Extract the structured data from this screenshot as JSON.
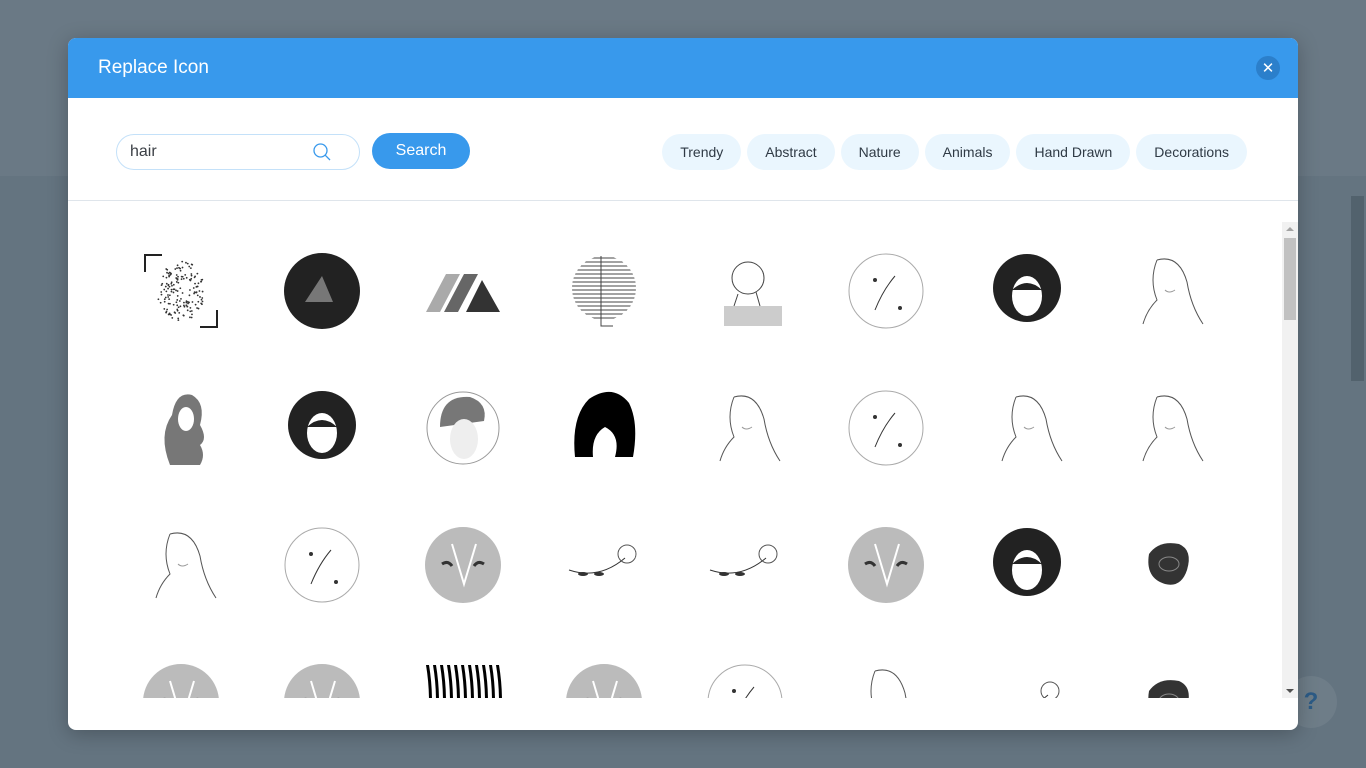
{
  "dialog": {
    "title": "Replace Icon",
    "close_icon": "close-icon",
    "search": {
      "value": "hair",
      "placeholder": "",
      "button_label": "Search"
    },
    "categories": [
      "Trendy",
      "Abstract",
      "Nature",
      "Animals",
      "Hand Drawn",
      "Decorations"
    ],
    "icons": [
      {
        "name": "fingerprint-frame",
        "style": "dots"
      },
      {
        "name": "triangle-dark-circle",
        "style": "dark-circle-triangle"
      },
      {
        "name": "stripes-logo",
        "style": "stripes"
      },
      {
        "name": "line-circle",
        "style": "line-circle"
      },
      {
        "name": "statue-bust",
        "style": "bust"
      },
      {
        "name": "feather-circle",
        "style": "outline-circle"
      },
      {
        "name": "woman-hat",
        "style": "dark-face"
      },
      {
        "name": "woman-long-hair-outline",
        "style": "outline-face"
      },
      {
        "name": "wavy-hair-woman",
        "style": "gray-hair"
      },
      {
        "name": "woman-sunglasses-moon",
        "style": "dark-face"
      },
      {
        "name": "woman-flower-circle",
        "style": "gray-face-circle"
      },
      {
        "name": "black-bob-hair",
        "style": "black-hair"
      },
      {
        "name": "bob-hair-outline",
        "style": "outline-face"
      },
      {
        "name": "woman-rose-circle",
        "style": "outline-circle"
      },
      {
        "name": "woman-leaves-hair",
        "style": "outline-face"
      },
      {
        "name": "woman-leaves-outline",
        "style": "outline-face"
      },
      {
        "name": "woman-rose-hair",
        "style": "outline-face"
      },
      {
        "name": "scissors-leaves-circle",
        "style": "outline-circle"
      },
      {
        "name": "scissors-gray-circle",
        "style": "gray-circle"
      },
      {
        "name": "rose-branch",
        "style": "branch"
      },
      {
        "name": "hand-rose",
        "style": "branch"
      },
      {
        "name": "rose-gray-circle",
        "style": "gray-circle"
      },
      {
        "name": "woman-tropical-leaves",
        "style": "dark-face"
      },
      {
        "name": "dark-rose",
        "style": "dark-blob"
      },
      {
        "name": "rose-gray-circle-2",
        "style": "gray-circle"
      },
      {
        "name": "face-gray-circle",
        "style": "gray-circle"
      },
      {
        "name": "zebra-stripes",
        "style": "zebra"
      },
      {
        "name": "moon-stars",
        "style": "gray-circle"
      },
      {
        "name": "bird-wing",
        "style": "outline-circle"
      },
      {
        "name": "leaf-outline",
        "style": "outline-face"
      },
      {
        "name": "bird-branch",
        "style": "branch"
      },
      {
        "name": "queen-bee",
        "style": "dark-blob"
      }
    ]
  },
  "help": {
    "label": "?"
  }
}
